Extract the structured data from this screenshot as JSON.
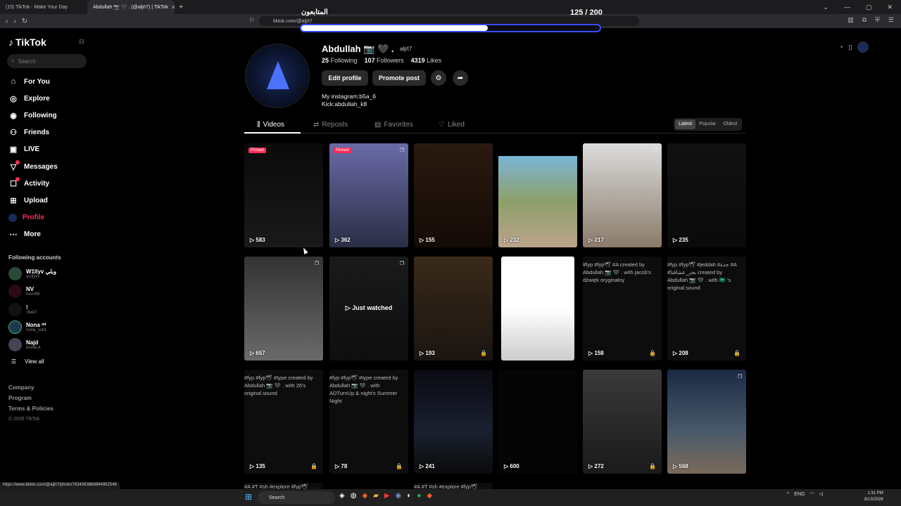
{
  "browser": {
    "tabs": [
      {
        "label": "(15) TikTok - Make Your Day"
      },
      {
        "label": "Abdullah 📷 🖤 . (@aljrt7) | TikTok"
      }
    ],
    "url": "tiktok.com/@aljrt7",
    "status_url": "https://www.tiktok.com/@aljrt7/photo/7634363868944952548"
  },
  "overlay": {
    "title": "المتابعون",
    "count": "125 / 200",
    "progress": 0.625
  },
  "sidebar": {
    "logo": "TikTok",
    "search_placeholder": "Search",
    "items": [
      {
        "label": "For You",
        "icon": "home-icon"
      },
      {
        "label": "Explore",
        "icon": "compass-icon"
      },
      {
        "label": "Following",
        "icon": "following-icon"
      },
      {
        "label": "Friends",
        "icon": "friends-icon"
      },
      {
        "label": "LIVE",
        "icon": "live-icon"
      },
      {
        "label": "Messages",
        "icon": "message-icon"
      },
      {
        "label": "Activity",
        "icon": "activity-icon"
      },
      {
        "label": "Upload",
        "icon": "upload-icon"
      },
      {
        "label": "Profile",
        "icon": "profile-icon"
      },
      {
        "label": "More",
        "icon": "more-icon"
      }
    ],
    "following_title": "Following accounts",
    "accounts": [
      {
        "name": "W1llyv وبلي",
        "handle": "w1llyvv"
      },
      {
        "name": "NV",
        "handle": "nvvn99"
      },
      {
        "name": "!",
        "handle": ".6wk7"
      },
      {
        "name": "Nona ᵐᵗ",
        "handle": "nona_sxb1"
      },
      {
        "name": "Najd",
        "handle": "esmki.4"
      }
    ],
    "view_all": "View all",
    "footer": {
      "company": "Company",
      "program": "Program",
      "terms": "Terms & Policies",
      "copyright": "© 2026 TikTok"
    }
  },
  "profile": {
    "name": "Abdullah 📷 🖤 .",
    "handle": "aljrt7",
    "following": "25",
    "following_label": "Following",
    "followers": "107",
    "followers_label": "Followers",
    "likes": "4319",
    "likes_label": "Likes",
    "edit_label": "Edit profile",
    "promote_label": "Promote post",
    "bio_line1": "My instagram:b5a_6",
    "bio_line2": "Kick:abdullah_k8"
  },
  "tabs": {
    "videos": "Videos",
    "reposts": "Reposts",
    "favorites": "Favorites",
    "liked": "Liked"
  },
  "sort": {
    "latest": "Latest",
    "popular": "Popular",
    "oldest": "Oldest"
  },
  "videos": [
    {
      "views": "583",
      "pinned": "Pinned"
    },
    {
      "views": "362",
      "pinned": "Pinned"
    },
    {
      "views": "155"
    },
    {
      "views": "232"
    },
    {
      "views": "217"
    },
    {
      "views": "235"
    },
    {
      "views": "657"
    },
    {
      "watched": "Just watched"
    },
    {
      "views": "193"
    },
    {
      "views": ""
    },
    {
      "views": "158",
      "alt": "#fyp #fyp🕊 #A created by Abdullah 📷 🖤 . with jacob's dźwięk oryginalny"
    },
    {
      "views": "208",
      "alt": "#fyp #fyp🕊 #jeddah #جدة #A #بحر_عشاقنا created by Abdullah 📷 🖤 . with 🇸🇦 's original sound"
    },
    {
      "views": "135",
      "alt": "#fyp #fyp🕊 #type created by Abdullah 📷 🖤 . with 26's original sound"
    },
    {
      "views": "78",
      "alt": "#fyp #fyp🕊 #type created by Abdullah 📷 🖤 . with ADTurnUp & night's Summer Night"
    },
    {
      "views": "241"
    },
    {
      "views": "600"
    },
    {
      "views": "272"
    },
    {
      "views": "568"
    }
  ],
  "row4_alt": [
    "#A #T #sh #explore #fyp🕊",
    "#A #T #sh #explore #fyp🕊"
  ],
  "taskbar": {
    "search": "Search",
    "lang": "ENG",
    "time": "1:31 PM",
    "date": "8/13/2026"
  },
  "colors": {
    "accent": "#fe2c55",
    "progress_border": "#3a4cff"
  }
}
